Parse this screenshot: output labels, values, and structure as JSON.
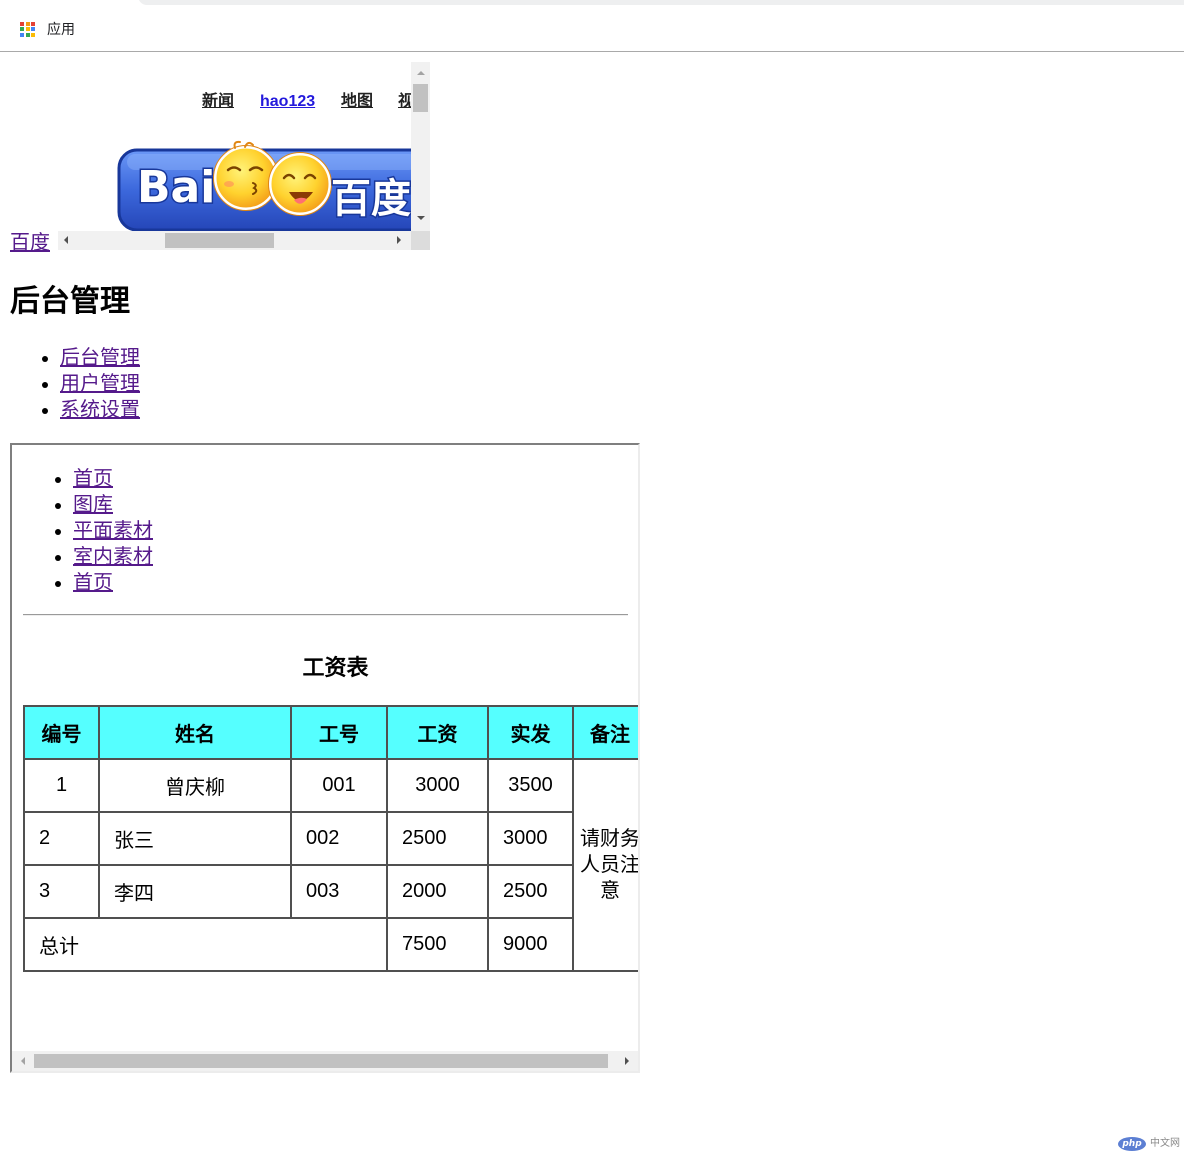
{
  "browser": {
    "bookmarks_bar": {
      "apps": {
        "icon": "apps-grid-icon",
        "label": "应用"
      }
    }
  },
  "page": {
    "baidu_link": "百度",
    "baidu_frame": {
      "nav_links": [
        "新闻",
        "hao123",
        "地图",
        "视"
      ],
      "logo": {
        "latin_text": "Bai",
        "chinese_text": "百度"
      }
    },
    "heading": "后台管理",
    "menu": [
      "后台管理",
      "用户管理",
      "系统设置"
    ],
    "content_frame": {
      "links": [
        "首页",
        "图库",
        "平面素材",
        "室内素材",
        "首页"
      ],
      "salary_table": {
        "caption": "工资表",
        "headers": [
          "编号",
          "姓名",
          "工号",
          "工资",
          "实发",
          "备注"
        ],
        "rows": [
          [
            "1",
            "曾庆柳",
            "001",
            "3000",
            "3500"
          ],
          [
            "2",
            "张三",
            "002",
            "2500",
            "3000"
          ],
          [
            "3",
            "李四",
            "003",
            "2000",
            "2500"
          ]
        ],
        "note": "请财务人员注意",
        "total": {
          "label": "总计",
          "salary": "7500",
          "paid": "9000"
        }
      }
    }
  },
  "watermark": {
    "logo_text": "php",
    "site_text": "中文网"
  },
  "colors": {
    "link_visited": "#551a8b",
    "baidu_nav_text": "#222222",
    "baidu_nav_hao123": "#2319dc",
    "table_header_bg": "#55ffff",
    "php_logo_blue": "#5c7fd3"
  }
}
